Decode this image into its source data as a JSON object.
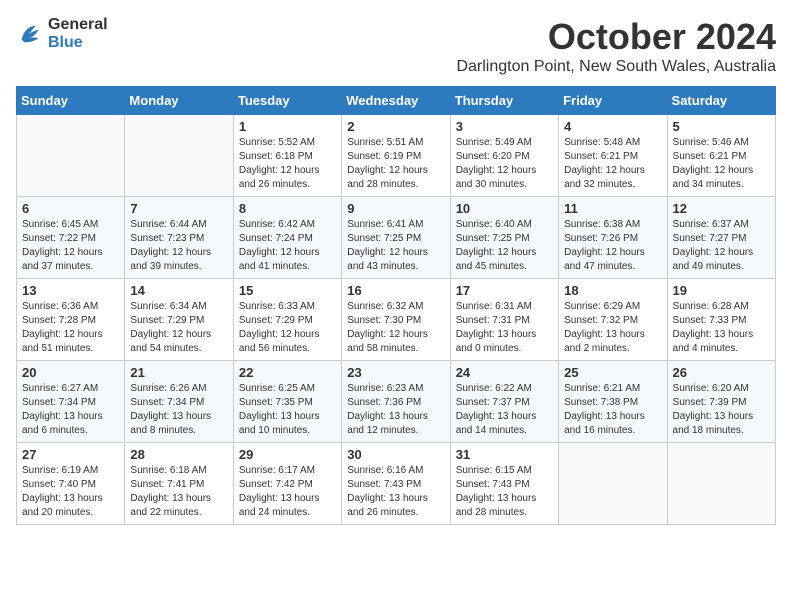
{
  "logo": {
    "line1": "General",
    "line2": "Blue"
  },
  "title": "October 2024",
  "location": "Darlington Point, New South Wales, Australia",
  "days_of_week": [
    "Sunday",
    "Monday",
    "Tuesday",
    "Wednesday",
    "Thursday",
    "Friday",
    "Saturday"
  ],
  "weeks": [
    [
      {
        "day": "",
        "sunrise": "",
        "sunset": "",
        "daylight": ""
      },
      {
        "day": "",
        "sunrise": "",
        "sunset": "",
        "daylight": ""
      },
      {
        "day": "1",
        "sunrise": "Sunrise: 5:52 AM",
        "sunset": "Sunset: 6:18 PM",
        "daylight": "Daylight: 12 hours and 26 minutes."
      },
      {
        "day": "2",
        "sunrise": "Sunrise: 5:51 AM",
        "sunset": "Sunset: 6:19 PM",
        "daylight": "Daylight: 12 hours and 28 minutes."
      },
      {
        "day": "3",
        "sunrise": "Sunrise: 5:49 AM",
        "sunset": "Sunset: 6:20 PM",
        "daylight": "Daylight: 12 hours and 30 minutes."
      },
      {
        "day": "4",
        "sunrise": "Sunrise: 5:48 AM",
        "sunset": "Sunset: 6:21 PM",
        "daylight": "Daylight: 12 hours and 32 minutes."
      },
      {
        "day": "5",
        "sunrise": "Sunrise: 5:46 AM",
        "sunset": "Sunset: 6:21 PM",
        "daylight": "Daylight: 12 hours and 34 minutes."
      }
    ],
    [
      {
        "day": "6",
        "sunrise": "Sunrise: 6:45 AM",
        "sunset": "Sunset: 7:22 PM",
        "daylight": "Daylight: 12 hours and 37 minutes."
      },
      {
        "day": "7",
        "sunrise": "Sunrise: 6:44 AM",
        "sunset": "Sunset: 7:23 PM",
        "daylight": "Daylight: 12 hours and 39 minutes."
      },
      {
        "day": "8",
        "sunrise": "Sunrise: 6:42 AM",
        "sunset": "Sunset: 7:24 PM",
        "daylight": "Daylight: 12 hours and 41 minutes."
      },
      {
        "day": "9",
        "sunrise": "Sunrise: 6:41 AM",
        "sunset": "Sunset: 7:25 PM",
        "daylight": "Daylight: 12 hours and 43 minutes."
      },
      {
        "day": "10",
        "sunrise": "Sunrise: 6:40 AM",
        "sunset": "Sunset: 7:25 PM",
        "daylight": "Daylight: 12 hours and 45 minutes."
      },
      {
        "day": "11",
        "sunrise": "Sunrise: 6:38 AM",
        "sunset": "Sunset: 7:26 PM",
        "daylight": "Daylight: 12 hours and 47 minutes."
      },
      {
        "day": "12",
        "sunrise": "Sunrise: 6:37 AM",
        "sunset": "Sunset: 7:27 PM",
        "daylight": "Daylight: 12 hours and 49 minutes."
      }
    ],
    [
      {
        "day": "13",
        "sunrise": "Sunrise: 6:36 AM",
        "sunset": "Sunset: 7:28 PM",
        "daylight": "Daylight: 12 hours and 51 minutes."
      },
      {
        "day": "14",
        "sunrise": "Sunrise: 6:34 AM",
        "sunset": "Sunset: 7:29 PM",
        "daylight": "Daylight: 12 hours and 54 minutes."
      },
      {
        "day": "15",
        "sunrise": "Sunrise: 6:33 AM",
        "sunset": "Sunset: 7:29 PM",
        "daylight": "Daylight: 12 hours and 56 minutes."
      },
      {
        "day": "16",
        "sunrise": "Sunrise: 6:32 AM",
        "sunset": "Sunset: 7:30 PM",
        "daylight": "Daylight: 12 hours and 58 minutes."
      },
      {
        "day": "17",
        "sunrise": "Sunrise: 6:31 AM",
        "sunset": "Sunset: 7:31 PM",
        "daylight": "Daylight: 13 hours and 0 minutes."
      },
      {
        "day": "18",
        "sunrise": "Sunrise: 6:29 AM",
        "sunset": "Sunset: 7:32 PM",
        "daylight": "Daylight: 13 hours and 2 minutes."
      },
      {
        "day": "19",
        "sunrise": "Sunrise: 6:28 AM",
        "sunset": "Sunset: 7:33 PM",
        "daylight": "Daylight: 13 hours and 4 minutes."
      }
    ],
    [
      {
        "day": "20",
        "sunrise": "Sunrise: 6:27 AM",
        "sunset": "Sunset: 7:34 PM",
        "daylight": "Daylight: 13 hours and 6 minutes."
      },
      {
        "day": "21",
        "sunrise": "Sunrise: 6:26 AM",
        "sunset": "Sunset: 7:34 PM",
        "daylight": "Daylight: 13 hours and 8 minutes."
      },
      {
        "day": "22",
        "sunrise": "Sunrise: 6:25 AM",
        "sunset": "Sunset: 7:35 PM",
        "daylight": "Daylight: 13 hours and 10 minutes."
      },
      {
        "day": "23",
        "sunrise": "Sunrise: 6:23 AM",
        "sunset": "Sunset: 7:36 PM",
        "daylight": "Daylight: 13 hours and 12 minutes."
      },
      {
        "day": "24",
        "sunrise": "Sunrise: 6:22 AM",
        "sunset": "Sunset: 7:37 PM",
        "daylight": "Daylight: 13 hours and 14 minutes."
      },
      {
        "day": "25",
        "sunrise": "Sunrise: 6:21 AM",
        "sunset": "Sunset: 7:38 PM",
        "daylight": "Daylight: 13 hours and 16 minutes."
      },
      {
        "day": "26",
        "sunrise": "Sunrise: 6:20 AM",
        "sunset": "Sunset: 7:39 PM",
        "daylight": "Daylight: 13 hours and 18 minutes."
      }
    ],
    [
      {
        "day": "27",
        "sunrise": "Sunrise: 6:19 AM",
        "sunset": "Sunset: 7:40 PM",
        "daylight": "Daylight: 13 hours and 20 minutes."
      },
      {
        "day": "28",
        "sunrise": "Sunrise: 6:18 AM",
        "sunset": "Sunset: 7:41 PM",
        "daylight": "Daylight: 13 hours and 22 minutes."
      },
      {
        "day": "29",
        "sunrise": "Sunrise: 6:17 AM",
        "sunset": "Sunset: 7:42 PM",
        "daylight": "Daylight: 13 hours and 24 minutes."
      },
      {
        "day": "30",
        "sunrise": "Sunrise: 6:16 AM",
        "sunset": "Sunset: 7:43 PM",
        "daylight": "Daylight: 13 hours and 26 minutes."
      },
      {
        "day": "31",
        "sunrise": "Sunrise: 6:15 AM",
        "sunset": "Sunset: 7:43 PM",
        "daylight": "Daylight: 13 hours and 28 minutes."
      },
      {
        "day": "",
        "sunrise": "",
        "sunset": "",
        "daylight": ""
      },
      {
        "day": "",
        "sunrise": "",
        "sunset": "",
        "daylight": ""
      }
    ]
  ]
}
